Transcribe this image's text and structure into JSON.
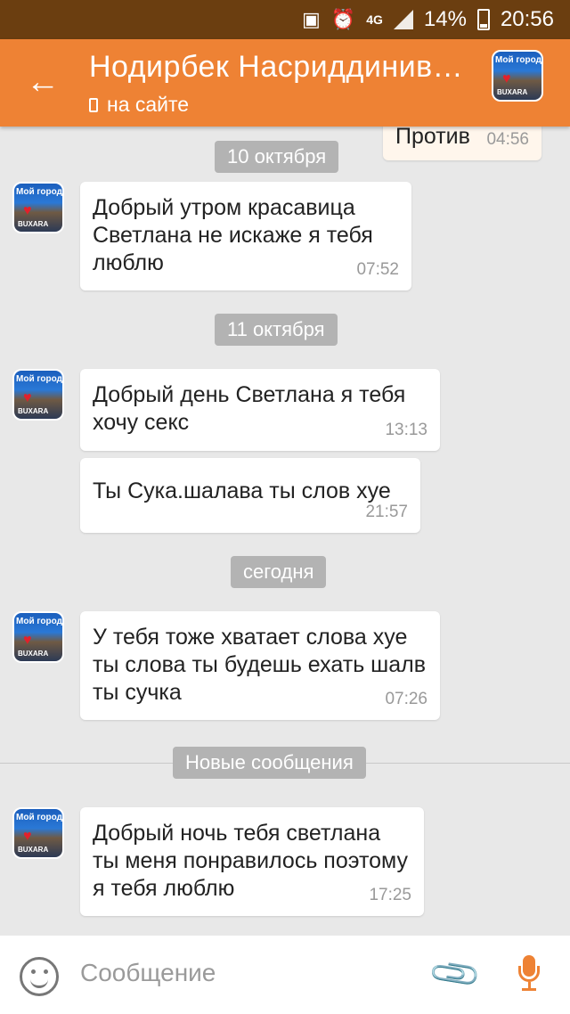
{
  "status_bar": {
    "network": "4G",
    "battery": "14%",
    "time": "20:56"
  },
  "header": {
    "title": "Нодирбек Насриддинив…",
    "status": "на сайте",
    "avatar": {
      "line1": "Мой город",
      "line2": "BUXARA"
    }
  },
  "messages": {
    "partial_out": {
      "text": "Против",
      "time": "04:56"
    },
    "date1": "10 октября",
    "m1": {
      "text": "Добрый утром красавица Светлана не искаже я тебя люблю",
      "time": "07:52"
    },
    "date2": "11 октября",
    "m2": {
      "text": "Добрый день Светлана я тебя хочу секс",
      "time": "13:13"
    },
    "m3": {
      "text": "Ты Сука.шалава ты слов хуе",
      "time": "21:57"
    },
    "date3": "сегодня",
    "m4": {
      "text": "У тебя тоже хватает слова хуе ты слова ты будешь ехать шалв ты сучка",
      "time": "07:26"
    },
    "new_messages": "Новые сообщения",
    "m5": {
      "text": "Добрый ночь тебя светлана ты меня понравилось поэтому я тебя люблю",
      "time": "17:25"
    }
  },
  "input": {
    "placeholder": "Сообщение"
  },
  "colors": {
    "accent": "#ee8234",
    "status_bar": "#6b3e10"
  }
}
